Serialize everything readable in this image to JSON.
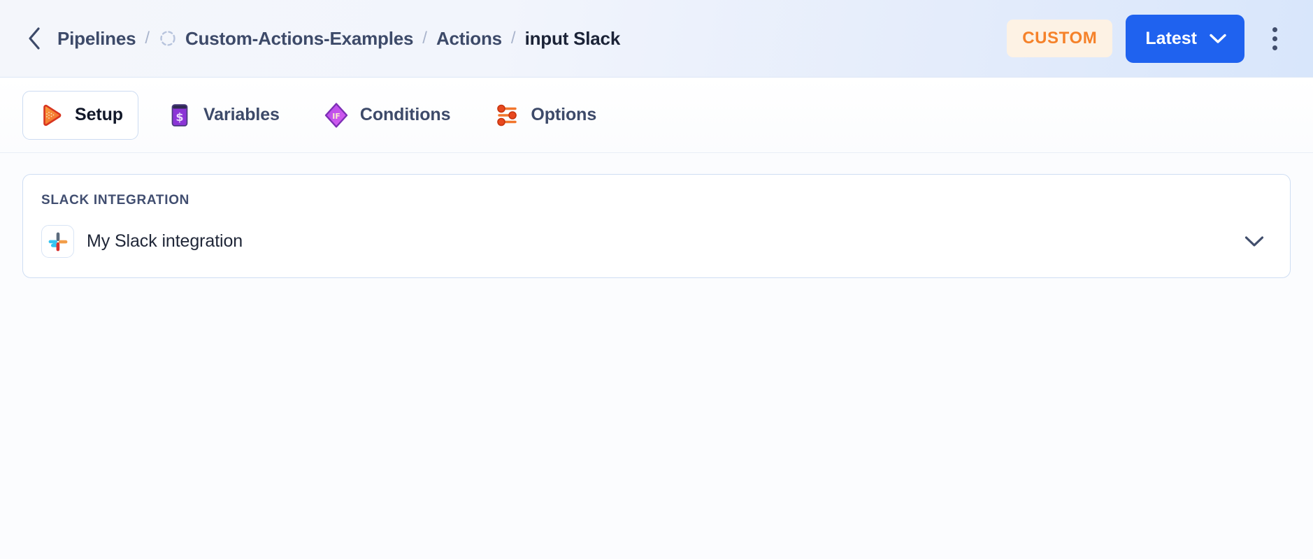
{
  "header": {
    "back_icon": "chevron-left-icon",
    "breadcrumb": {
      "separator": "/",
      "items": [
        {
          "label": "Pipelines",
          "icon": null,
          "current": false
        },
        {
          "label": "Custom-Actions-Examples",
          "icon": "loading-spinner-icon",
          "current": false
        },
        {
          "label": "Actions",
          "icon": null,
          "current": false
        },
        {
          "label": "input Slack",
          "icon": null,
          "current": true
        }
      ]
    },
    "badge": {
      "label": "CUSTOM",
      "text_color": "#f5822a",
      "bg_color": "#fdf2e4"
    },
    "version_button": {
      "label": "Latest",
      "icon": "chevron-down-icon",
      "bg_color": "#1f62ef",
      "text_color": "#ffffff"
    },
    "overflow_menu": {
      "icon": "kebab-menu-icon",
      "label": "More options"
    }
  },
  "tabs": [
    {
      "label": "Setup",
      "icon": "play-triangle-icon",
      "active": true,
      "icon_color": "#f2762d"
    },
    {
      "label": "Variables",
      "icon": "dollar-variable-icon",
      "active": false,
      "icon_color": "#8b35d6"
    },
    {
      "label": "Conditions",
      "icon": "if-diamond-icon",
      "active": false,
      "icon_color": "#c054e8"
    },
    {
      "label": "Options",
      "icon": "sliders-icon",
      "active": false,
      "icon_color": "#e8481f"
    }
  ],
  "main": {
    "card": {
      "label": "SLACK INTEGRATION",
      "select": {
        "icon": "slack-logo-icon",
        "value": "My Slack integration",
        "chevron": "chevron-down-icon"
      }
    }
  }
}
